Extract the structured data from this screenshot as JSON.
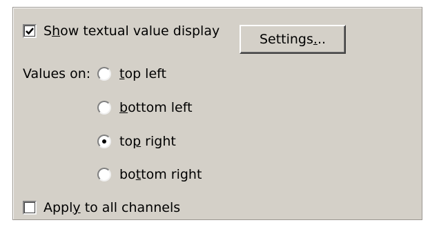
{
  "panel": {
    "show_textual": {
      "checked": true,
      "label_parts": [
        "S",
        "h",
        "ow textual value display"
      ]
    },
    "settings_button": {
      "label_parts": [
        "Settings",
        ".",
        ".."
      ]
    },
    "values_on_label": "Values on:",
    "positions": [
      {
        "label_parts": [
          "",
          "t",
          "op left"
        ],
        "selected": false
      },
      {
        "label_parts": [
          "",
          "b",
          "ottom left"
        ],
        "selected": false
      },
      {
        "label_parts": [
          "to",
          "p",
          " right"
        ],
        "selected": true
      },
      {
        "label_parts": [
          "bo",
          "t",
          "tom right"
        ],
        "selected": false
      }
    ],
    "apply_all": {
      "checked": false,
      "label_parts": [
        "Appl",
        "y",
        " to all channels"
      ]
    }
  }
}
